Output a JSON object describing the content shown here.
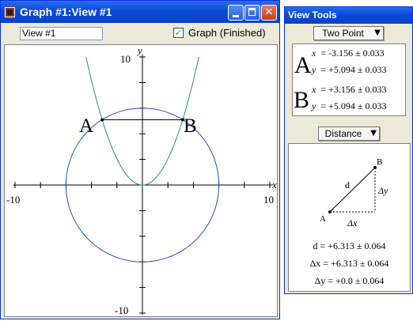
{
  "graph_window": {
    "title": "Graph #1:View #1",
    "view_name": "View #1",
    "graph_checkbox_label": "Graph (Finished)",
    "graph_checked": true
  },
  "plot": {
    "x_axis_label": "x",
    "y_axis_label": "y",
    "x_min_label": "-10",
    "x_max_label": "10",
    "y_max_label": "10",
    "y_min_label": "-10",
    "x_range": [
      -10,
      10
    ],
    "y_range": [
      -10,
      10
    ],
    "circle": {
      "center": [
        0,
        0
      ],
      "radius": 6,
      "color": "#1f4fc4"
    },
    "parabola": {
      "a": 0.51,
      "color": "#1e9a5c"
    },
    "point_A": {
      "label": "A",
      "x": -3.156,
      "y": 5.094
    },
    "point_B": {
      "label": "B",
      "x": 3.156,
      "y": 5.094
    }
  },
  "view_tools": {
    "title": "View Tools",
    "mode_dropdown": "Two Point",
    "point_A": {
      "letter": "A",
      "x_label": "x",
      "x_value": "= -3.156 ± 0.033",
      "y_label": "y",
      "y_value": "= +5.094 ± 0.033"
    },
    "point_B": {
      "letter": "B",
      "x_label": "x",
      "x_value": "= +3.156 ± 0.033",
      "y_label": "y",
      "y_value": "= +5.094 ± 0.033"
    },
    "measure_dropdown": "Distance",
    "diagram": {
      "A": "A",
      "B": "B",
      "d": "d",
      "dx": "Δx",
      "dy": "Δy"
    },
    "d_value": "d = +6.313 ± 0.064",
    "dx_value": "Δx = +6.313 ± 0.064",
    "dy_value": "Δy = +0.0 ± 0.064"
  },
  "icons": {
    "app": "app-icon",
    "minimize": "minimize-icon",
    "maximize": "maximize-icon",
    "close": "close-icon",
    "dropdown": "chevron-down-icon"
  }
}
